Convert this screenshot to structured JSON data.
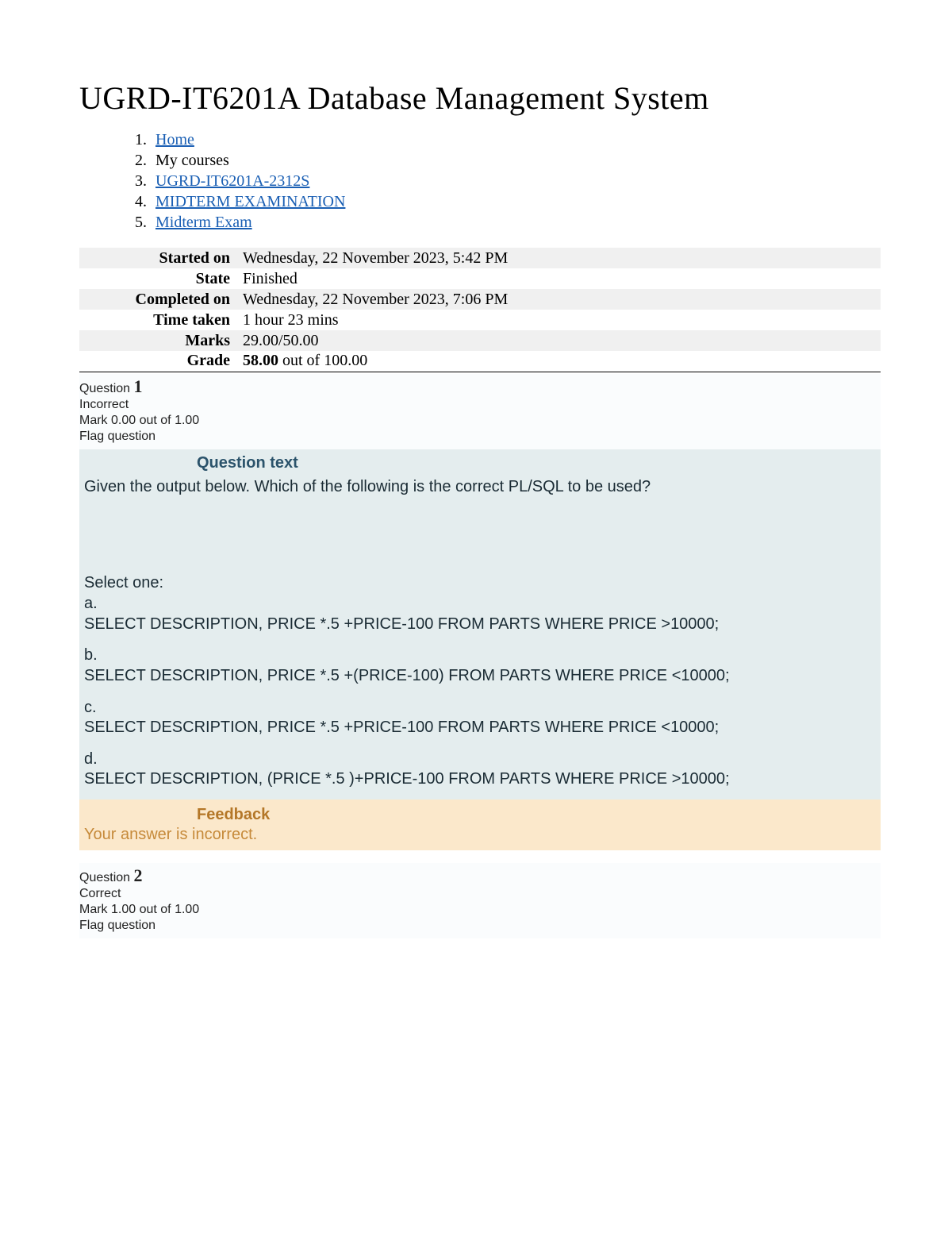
{
  "page": {
    "title": "UGRD-IT6201A Database Management System"
  },
  "breadcrumb": {
    "items": [
      {
        "label": "Home",
        "is_link": true
      },
      {
        "label": "My courses",
        "is_link": false
      },
      {
        "label": "UGRD-IT6201A-2312S",
        "is_link": true
      },
      {
        "label": "MIDTERM EXAMINATION",
        "is_link": true
      },
      {
        "label": "Midterm Exam",
        "is_link": true
      }
    ]
  },
  "summary": {
    "rows": [
      {
        "label": "Started on",
        "value": "Wednesday, 22 November 2023, 5:42 PM"
      },
      {
        "label": "State",
        "value": "Finished"
      },
      {
        "label": "Completed on",
        "value": "Wednesday, 22 November 2023, 7:06 PM"
      },
      {
        "label": "Time taken",
        "value": "1 hour 23 mins"
      },
      {
        "label": "Marks",
        "value": "29.00/50.00"
      }
    ],
    "grade_label": "Grade",
    "grade_bold": "58.00",
    "grade_rest": " out of 100.00"
  },
  "question1": {
    "label": "Question ",
    "number": "1",
    "status": "Incorrect",
    "mark": "Mark 0.00 out of 1.00",
    "flag": "Flag question",
    "text_header": "Question text",
    "prompt": "Given the output below. Which of the following is the correct PL/SQL to be used?",
    "select_one": "Select one:",
    "options": [
      {
        "letter": "a.",
        "text": "SELECT DESCRIPTION, PRICE *.5 +PRICE-100 FROM PARTS WHERE PRICE >10000;"
      },
      {
        "letter": "b.",
        "text": "SELECT DESCRIPTION, PRICE *.5 +(PRICE-100) FROM PARTS WHERE PRICE <10000;"
      },
      {
        "letter": "c.",
        "text": "SELECT DESCRIPTION, PRICE *.5 +PRICE-100 FROM PARTS WHERE PRICE <10000;"
      },
      {
        "letter": "d.",
        "text": "SELECT DESCRIPTION, (PRICE *.5 )+PRICE-100 FROM PARTS WHERE PRICE >10000;"
      }
    ],
    "feedback_header": "Feedback",
    "feedback_text": "Your answer is incorrect."
  },
  "question2": {
    "label": "Question ",
    "number": "2",
    "status": "Correct",
    "mark": "Mark 1.00 out of 1.00",
    "flag": "Flag question"
  }
}
